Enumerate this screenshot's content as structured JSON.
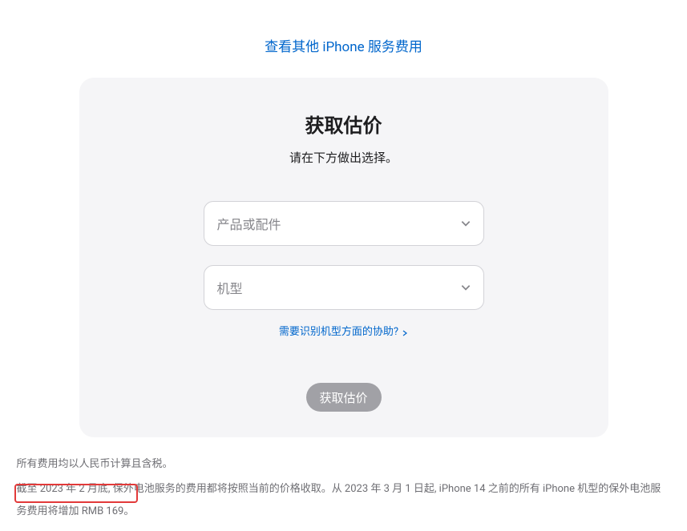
{
  "topLink": {
    "label": "查看其他 iPhone 服务费用"
  },
  "card": {
    "title": "获取估价",
    "subtitle": "请在下方做出选择。",
    "productSelect": {
      "placeholder": "产品或配件"
    },
    "modelSelect": {
      "placeholder": "机型"
    },
    "helpLink": {
      "label": "需要识别机型方面的协助?"
    },
    "submitButton": {
      "label": "获取估价"
    }
  },
  "footnotes": {
    "line1": "所有费用均以人民币计算且含税。",
    "line2": "截至 2023 年 2 月底, 保外电池服务的费用都将按照当前的价格收取。从 2023 年 3 月 1 日起, iPhone 14 之前的所有 iPhone 机型的保外电池服务费用将增加 RMB 169。"
  }
}
